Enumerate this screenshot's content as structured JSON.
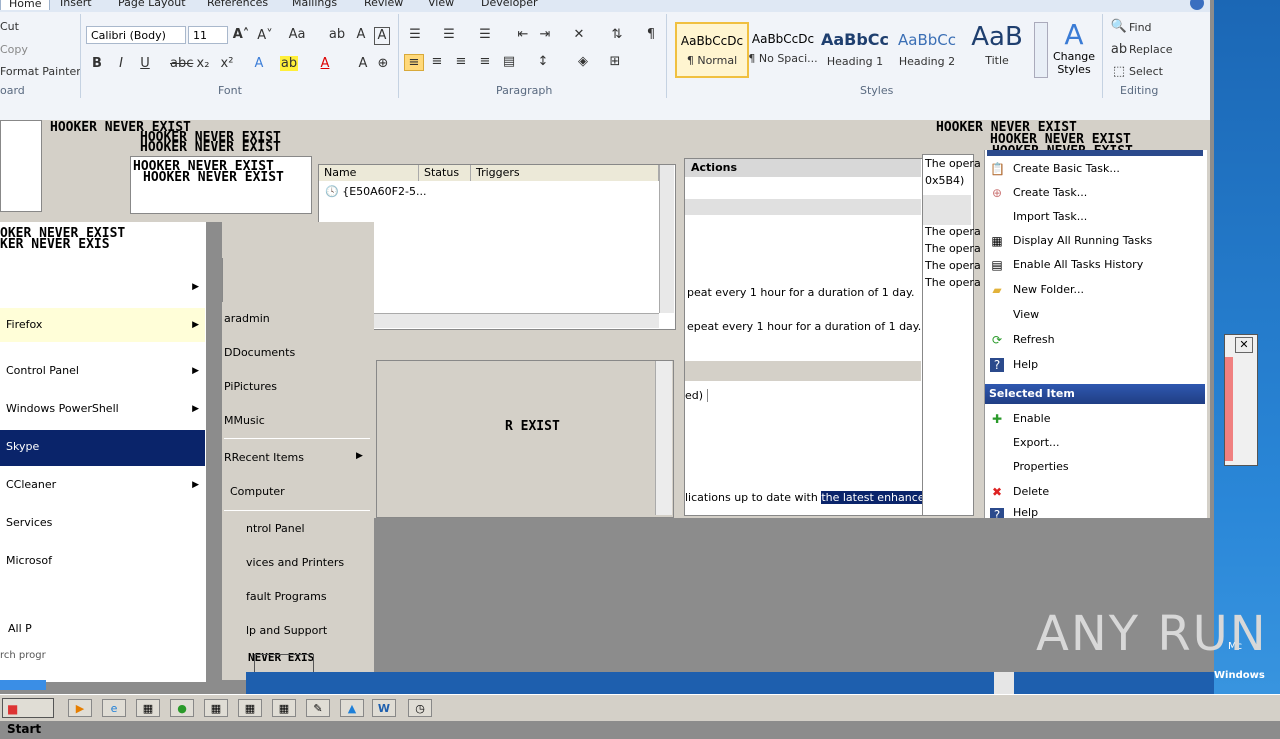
{
  "word": {
    "tabs": [
      "Home",
      "Insert",
      "Page Layout",
      "References",
      "Mailings",
      "Review",
      "View",
      "Developer"
    ],
    "clipboard": {
      "cut": "Cut",
      "copy": "Copy",
      "format_painter": "Format Painter",
      "label": "oard"
    },
    "font": {
      "name": "Calibri (Body)",
      "size": "11",
      "label": "Font"
    },
    "paragraph": {
      "label": "Paragraph"
    },
    "styles": {
      "label": "Styles",
      "items": [
        {
          "sample": "AaBbCcDc",
          "name": "¶ Normal"
        },
        {
          "sample": "AaBbCcDc",
          "name": "¶ No Spaci..."
        },
        {
          "sample": "AaBbCc",
          "name": "Heading 1"
        },
        {
          "sample": "AaBbCc",
          "name": "Heading 2"
        },
        {
          "sample": "AaB",
          "name": "Title"
        }
      ],
      "change": "Change Styles"
    },
    "editing": {
      "find": "Find",
      "replace": "Replace",
      "select": "Select",
      "label": "Editing"
    }
  },
  "scheduler": {
    "columns": [
      "Name",
      "Status",
      "Triggers"
    ],
    "task_name": "{E50A60F2-5...",
    "actions_header": "Actions",
    "trigger_line": "peat every 1 hour for a duration of 1 day.",
    "trigger_line2": "epeat every 1 hour for a duration of 1 day.",
    "desc_prefix": "lications up to date with",
    "desc_highlight": "the latest enhancem",
    "status_partial": "ed)",
    "history": [
      "The opera",
      "0x5B4)",
      "The opera",
      "The opera",
      "The opera",
      "The opera"
    ],
    "actions": [
      "Create Basic Task...",
      "Create Task...",
      "Import Task...",
      "Display All Running Tasks",
      "Enable All Tasks History",
      "New Folder...",
      "View",
      "Refresh",
      "Help"
    ],
    "selected_header": "Selected Item",
    "selected_actions": [
      "Enable",
      "Export...",
      "Properties",
      "Delete",
      "Help"
    ]
  },
  "glitch_text": "HOOKER NEVER EXIST",
  "glitch_text_b": "OKER NEVER EXIST",
  "glitch_text_c": "KER NEVER EXIS",
  "glitch_text_d": "R EXIST",
  "glitch_text_e": "NEVER EXIS",
  "startmenu": {
    "left": [
      {
        "label": "",
        "arrow": true
      },
      {
        "label": "Firefox",
        "arrow": true
      },
      {
        "label": "Control Panel",
        "arrow": true
      },
      {
        "label": "Windows PowerShell",
        "arrow": true
      },
      {
        "label": "Skype",
        "arrow": false
      },
      {
        "label": "CCleaner",
        "arrow": true
      },
      {
        "label": "Services",
        "arrow": false
      },
      {
        "label": "Microsof",
        "arrow": false
      }
    ],
    "all_programs": "All P",
    "search_stub": "rch progr",
    "right": [
      "aradmin",
      "DDocuments",
      "PiPictures",
      "MMusic",
      "RRecent Items",
      "Computer",
      "ntrol Panel",
      "vices and Printers",
      "fault Programs",
      "lp and Support"
    ]
  },
  "taskbar": {
    "start": "Start"
  },
  "watermark": "ANY RUN",
  "tray": {
    "line1": "Mc",
    "line2": "Windows"
  }
}
